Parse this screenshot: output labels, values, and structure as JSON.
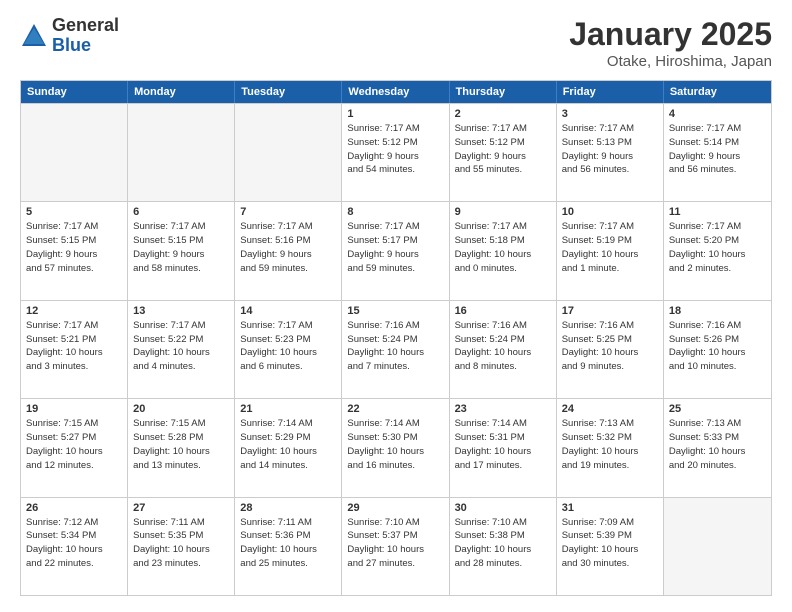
{
  "header": {
    "logo_general": "General",
    "logo_blue": "Blue",
    "title": "January 2025",
    "subtitle": "Otake, Hiroshima, Japan"
  },
  "days_of_week": [
    "Sunday",
    "Monday",
    "Tuesday",
    "Wednesday",
    "Thursday",
    "Friday",
    "Saturday"
  ],
  "rows": [
    {
      "cells": [
        {
          "day": "",
          "info": "",
          "shaded": true
        },
        {
          "day": "",
          "info": "",
          "shaded": true
        },
        {
          "day": "",
          "info": "",
          "shaded": true
        },
        {
          "day": "1",
          "info": "Sunrise: 7:17 AM\nSunset: 5:12 PM\nDaylight: 9 hours\nand 54 minutes.",
          "shaded": false
        },
        {
          "day": "2",
          "info": "Sunrise: 7:17 AM\nSunset: 5:12 PM\nDaylight: 9 hours\nand 55 minutes.",
          "shaded": false
        },
        {
          "day": "3",
          "info": "Sunrise: 7:17 AM\nSunset: 5:13 PM\nDaylight: 9 hours\nand 56 minutes.",
          "shaded": false
        },
        {
          "day": "4",
          "info": "Sunrise: 7:17 AM\nSunset: 5:14 PM\nDaylight: 9 hours\nand 56 minutes.",
          "shaded": false
        }
      ]
    },
    {
      "cells": [
        {
          "day": "5",
          "info": "Sunrise: 7:17 AM\nSunset: 5:15 PM\nDaylight: 9 hours\nand 57 minutes.",
          "shaded": false
        },
        {
          "day": "6",
          "info": "Sunrise: 7:17 AM\nSunset: 5:15 PM\nDaylight: 9 hours\nand 58 minutes.",
          "shaded": false
        },
        {
          "day": "7",
          "info": "Sunrise: 7:17 AM\nSunset: 5:16 PM\nDaylight: 9 hours\nand 59 minutes.",
          "shaded": false
        },
        {
          "day": "8",
          "info": "Sunrise: 7:17 AM\nSunset: 5:17 PM\nDaylight: 9 hours\nand 59 minutes.",
          "shaded": false
        },
        {
          "day": "9",
          "info": "Sunrise: 7:17 AM\nSunset: 5:18 PM\nDaylight: 10 hours\nand 0 minutes.",
          "shaded": false
        },
        {
          "day": "10",
          "info": "Sunrise: 7:17 AM\nSunset: 5:19 PM\nDaylight: 10 hours\nand 1 minute.",
          "shaded": false
        },
        {
          "day": "11",
          "info": "Sunrise: 7:17 AM\nSunset: 5:20 PM\nDaylight: 10 hours\nand 2 minutes.",
          "shaded": false
        }
      ]
    },
    {
      "cells": [
        {
          "day": "12",
          "info": "Sunrise: 7:17 AM\nSunset: 5:21 PM\nDaylight: 10 hours\nand 3 minutes.",
          "shaded": false
        },
        {
          "day": "13",
          "info": "Sunrise: 7:17 AM\nSunset: 5:22 PM\nDaylight: 10 hours\nand 4 minutes.",
          "shaded": false
        },
        {
          "day": "14",
          "info": "Sunrise: 7:17 AM\nSunset: 5:23 PM\nDaylight: 10 hours\nand 6 minutes.",
          "shaded": false
        },
        {
          "day": "15",
          "info": "Sunrise: 7:16 AM\nSunset: 5:24 PM\nDaylight: 10 hours\nand 7 minutes.",
          "shaded": false
        },
        {
          "day": "16",
          "info": "Sunrise: 7:16 AM\nSunset: 5:24 PM\nDaylight: 10 hours\nand 8 minutes.",
          "shaded": false
        },
        {
          "day": "17",
          "info": "Sunrise: 7:16 AM\nSunset: 5:25 PM\nDaylight: 10 hours\nand 9 minutes.",
          "shaded": false
        },
        {
          "day": "18",
          "info": "Sunrise: 7:16 AM\nSunset: 5:26 PM\nDaylight: 10 hours\nand 10 minutes.",
          "shaded": false
        }
      ]
    },
    {
      "cells": [
        {
          "day": "19",
          "info": "Sunrise: 7:15 AM\nSunset: 5:27 PM\nDaylight: 10 hours\nand 12 minutes.",
          "shaded": false
        },
        {
          "day": "20",
          "info": "Sunrise: 7:15 AM\nSunset: 5:28 PM\nDaylight: 10 hours\nand 13 minutes.",
          "shaded": false
        },
        {
          "day": "21",
          "info": "Sunrise: 7:14 AM\nSunset: 5:29 PM\nDaylight: 10 hours\nand 14 minutes.",
          "shaded": false
        },
        {
          "day": "22",
          "info": "Sunrise: 7:14 AM\nSunset: 5:30 PM\nDaylight: 10 hours\nand 16 minutes.",
          "shaded": false
        },
        {
          "day": "23",
          "info": "Sunrise: 7:14 AM\nSunset: 5:31 PM\nDaylight: 10 hours\nand 17 minutes.",
          "shaded": false
        },
        {
          "day": "24",
          "info": "Sunrise: 7:13 AM\nSunset: 5:32 PM\nDaylight: 10 hours\nand 19 minutes.",
          "shaded": false
        },
        {
          "day": "25",
          "info": "Sunrise: 7:13 AM\nSunset: 5:33 PM\nDaylight: 10 hours\nand 20 minutes.",
          "shaded": false
        }
      ]
    },
    {
      "cells": [
        {
          "day": "26",
          "info": "Sunrise: 7:12 AM\nSunset: 5:34 PM\nDaylight: 10 hours\nand 22 minutes.",
          "shaded": false
        },
        {
          "day": "27",
          "info": "Sunrise: 7:11 AM\nSunset: 5:35 PM\nDaylight: 10 hours\nand 23 minutes.",
          "shaded": false
        },
        {
          "day": "28",
          "info": "Sunrise: 7:11 AM\nSunset: 5:36 PM\nDaylight: 10 hours\nand 25 minutes.",
          "shaded": false
        },
        {
          "day": "29",
          "info": "Sunrise: 7:10 AM\nSunset: 5:37 PM\nDaylight: 10 hours\nand 27 minutes.",
          "shaded": false
        },
        {
          "day": "30",
          "info": "Sunrise: 7:10 AM\nSunset: 5:38 PM\nDaylight: 10 hours\nand 28 minutes.",
          "shaded": false
        },
        {
          "day": "31",
          "info": "Sunrise: 7:09 AM\nSunset: 5:39 PM\nDaylight: 10 hours\nand 30 minutes.",
          "shaded": false
        },
        {
          "day": "",
          "info": "",
          "shaded": true
        }
      ]
    }
  ]
}
